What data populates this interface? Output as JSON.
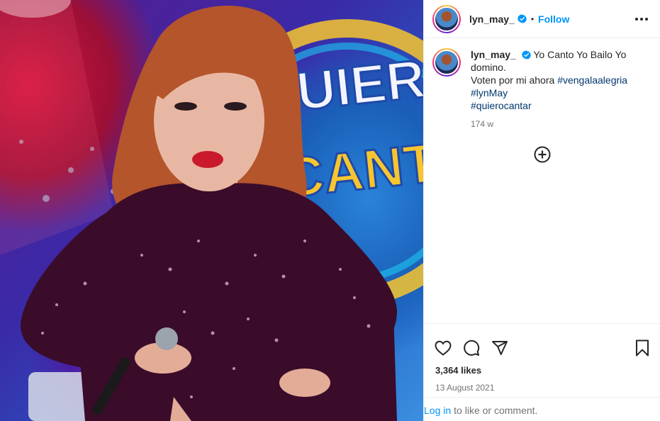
{
  "post": {
    "username": "lyn_may_",
    "follow_label": "Follow",
    "dot": "•",
    "caption": {
      "username": "lyn_may_",
      "text_line1": "Yo Canto Yo Bailo Yo domino.",
      "text_line2": "Voten por mi ahora",
      "hashtags": [
        "#vengalaalegria",
        "#lynMay",
        "#quierocantar"
      ]
    },
    "time_ago": "174 w",
    "likes": "3,364 likes",
    "date": "13 August 2021",
    "login": {
      "link": "Log in",
      "suffix": "to like or comment."
    },
    "photo": {
      "backdrop_text_lines": [
        "QUIER",
        "CANT"
      ]
    }
  },
  "icons": {
    "verified": "verified-badge-icon",
    "more": "more-options-icon",
    "load_more": "load-more-comments-icon",
    "like": "heart-icon",
    "comment": "comment-icon",
    "share": "share-icon",
    "save": "bookmark-icon"
  },
  "colors": {
    "link_blue": "#0095f6",
    "hashtag": "#00376b",
    "secondary": "#737373",
    "verified": "#0095f6"
  }
}
